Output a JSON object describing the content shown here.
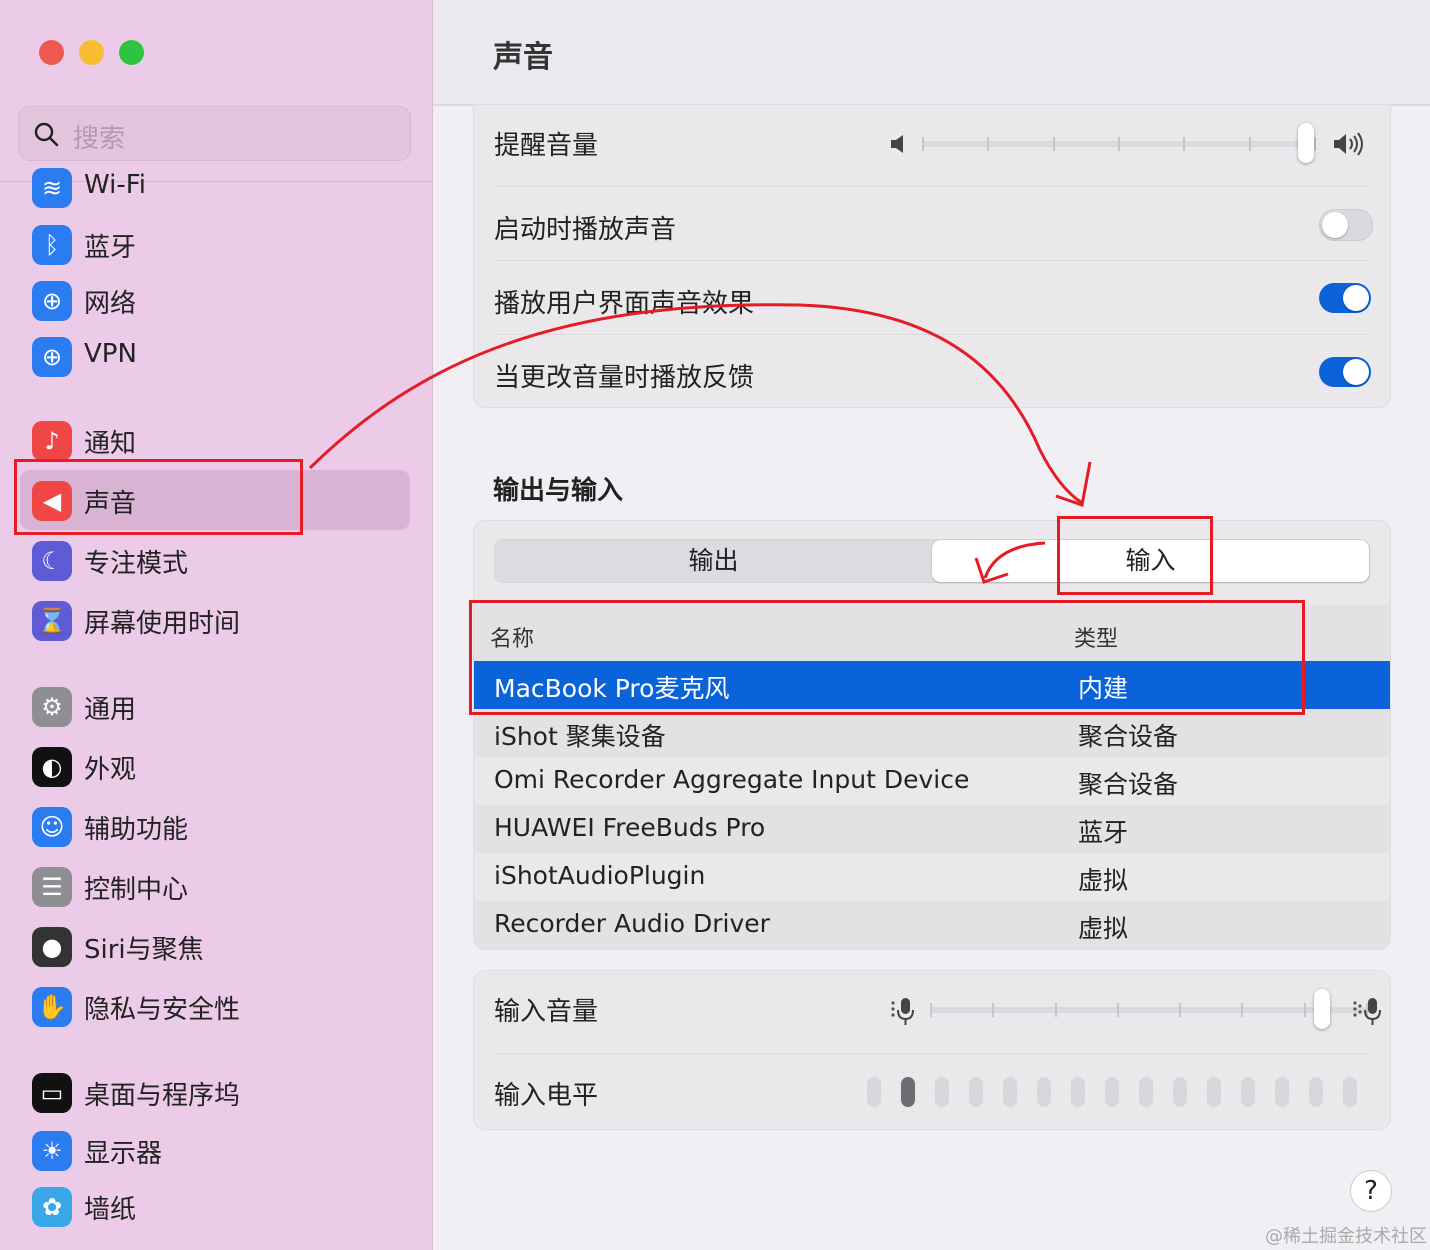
{
  "window": {
    "title": "声音"
  },
  "colors": {
    "accent": "#0a63d8",
    "close": "#ee5a52",
    "minimize": "#f5bd2f",
    "zoom": "#2cc440",
    "annotation": "#e31c26"
  },
  "search": {
    "placeholder": "搜索",
    "icon": "search-icon"
  },
  "sidebar": {
    "items": [
      {
        "label": "Wi-Fi",
        "icon": "wifi-icon",
        "color": "#2b7cf1"
      },
      {
        "label": "蓝牙",
        "icon": "bluetooth-icon",
        "color": "#2b7cf1"
      },
      {
        "label": "网络",
        "icon": "globe-icon",
        "color": "#2b7cf1"
      },
      {
        "label": "VPN",
        "icon": "vpn-icon",
        "color": "#2b7cf1"
      },
      {
        "label": "通知",
        "icon": "bell-icon",
        "color": "#f04646"
      },
      {
        "label": "声音",
        "icon": "speaker-icon",
        "color": "#f04646",
        "selected": true
      },
      {
        "label": "专注模式",
        "icon": "moon-icon",
        "color": "#5f5ad6"
      },
      {
        "label": "屏幕使用时间",
        "icon": "hourglass-icon",
        "color": "#5f5ad6"
      },
      {
        "label": "通用",
        "icon": "gear-icon",
        "color": "#8e8e93"
      },
      {
        "label": "外观",
        "icon": "appearance-icon",
        "color": "#111111"
      },
      {
        "label": "辅助功能",
        "icon": "accessibility-icon",
        "color": "#2b7cf1"
      },
      {
        "label": "控制中心",
        "icon": "control-center-icon",
        "color": "#8e8e93"
      },
      {
        "label": "Siri与聚焦",
        "icon": "siri-icon",
        "color": "#333333"
      },
      {
        "label": "隐私与安全性",
        "icon": "hand-icon",
        "color": "#2b7cf1"
      },
      {
        "label": "桌面与程序坞",
        "icon": "dock-icon",
        "color": "#111111"
      },
      {
        "label": "显示器",
        "icon": "sun-icon",
        "color": "#2b7cf1"
      },
      {
        "label": "墙纸",
        "icon": "flower-icon",
        "color": "#3aa7e8"
      }
    ]
  },
  "sound": {
    "alert_volume_label": "提醒音量",
    "alert_volume_level": 0.98,
    "startup_sound_label": "启动时播放声音",
    "startup_sound_on": false,
    "ui_effects_label": "播放用户界面声音效果",
    "ui_effects_on": true,
    "volume_feedback_label": "当更改音量时播放反馈",
    "volume_feedback_on": true
  },
  "io": {
    "section_title": "输出与输入",
    "tabs": [
      "输出",
      "输入"
    ],
    "active_tab": 1,
    "columns": [
      "名称",
      "类型"
    ],
    "devices": [
      {
        "name": "MacBook Pro麦克风",
        "type": "内建",
        "selected": true
      },
      {
        "name": "iShot 聚集设备",
        "type": "聚合设备"
      },
      {
        "name": "Omi Recorder Aggregate Input Device",
        "type": "聚合设备"
      },
      {
        "name": "HUAWEI FreeBuds Pro",
        "type": "蓝牙"
      },
      {
        "name": "iShotAudioPlugin",
        "type": "虚拟"
      },
      {
        "name": "Recorder Audio Driver",
        "type": "虚拟"
      }
    ]
  },
  "input": {
    "volume_label": "输入音量",
    "volume_level": 0.9,
    "level_label": "输入电平",
    "level_segments": 15,
    "level_active": 2
  },
  "help": {
    "label": "?"
  },
  "watermark": "@稀土掘金技术社区"
}
